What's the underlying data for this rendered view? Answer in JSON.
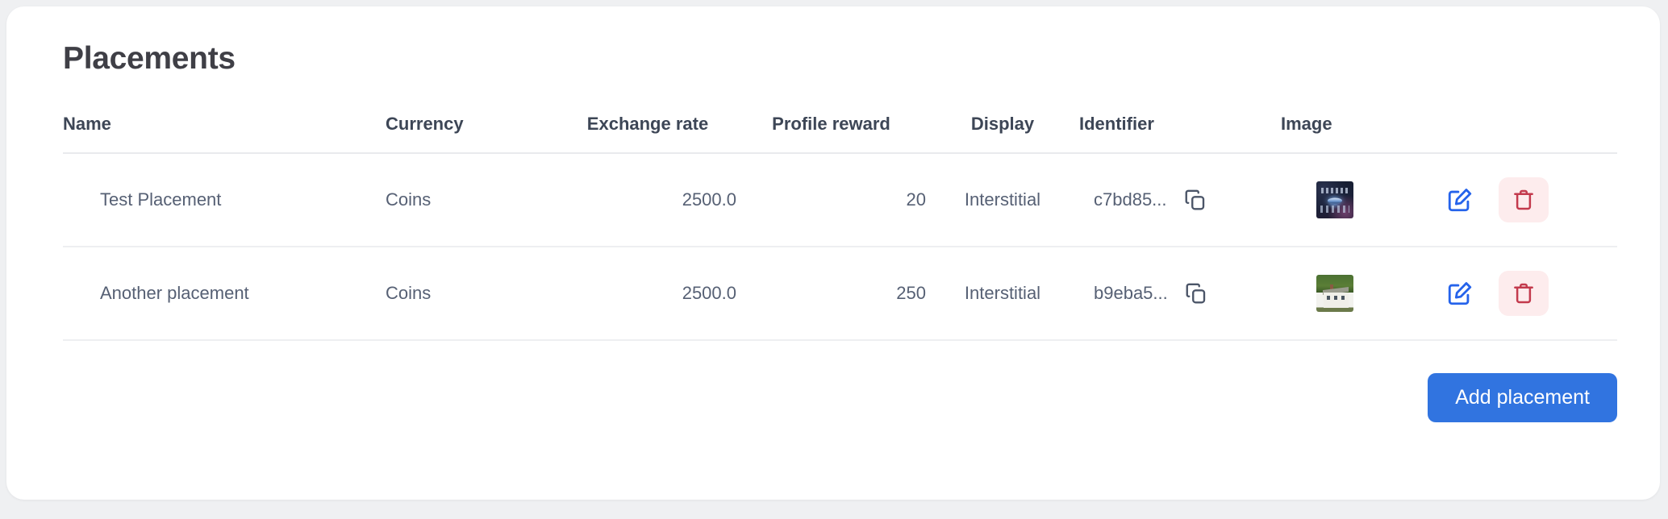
{
  "card": {
    "title": "Placements"
  },
  "table": {
    "columns": [
      {
        "key": "name",
        "label": "Name"
      },
      {
        "key": "currency",
        "label": "Currency"
      },
      {
        "key": "exchange",
        "label": "Exchange rate"
      },
      {
        "key": "reward",
        "label": "Profile reward"
      },
      {
        "key": "display",
        "label": "Display"
      },
      {
        "key": "identifier",
        "label": "Identifier"
      },
      {
        "key": "image",
        "label": "Image"
      }
    ],
    "rows": [
      {
        "name": "Test Placement",
        "currency": "Coins",
        "exchange": "2500.0",
        "reward": "20",
        "display": "Interstitial",
        "identifier": "c7bd85...",
        "image_kind": "space-thumbnail"
      },
      {
        "name": "Another placement",
        "currency": "Coins",
        "exchange": "2500.0",
        "reward": "250",
        "display": "Interstitial",
        "identifier": "b9eba5...",
        "image_kind": "house-thumbnail"
      }
    ]
  },
  "icons": {
    "copy": "copy-icon",
    "edit": "edit-pencil-square-icon",
    "delete": "trash-icon"
  },
  "footer": {
    "add_label": "Add placement"
  },
  "colors": {
    "page_background": "#eff0f2",
    "card_background": "#ffffff",
    "title": "#3f3f46",
    "header_text": "#3d4656",
    "cell_text": "#566074",
    "divider": "#e9eaed",
    "primary_button": "#3174e0",
    "edit_icon": "#2563eb",
    "delete_icon": "#c33a4d",
    "delete_button_background": "#fdeced"
  }
}
